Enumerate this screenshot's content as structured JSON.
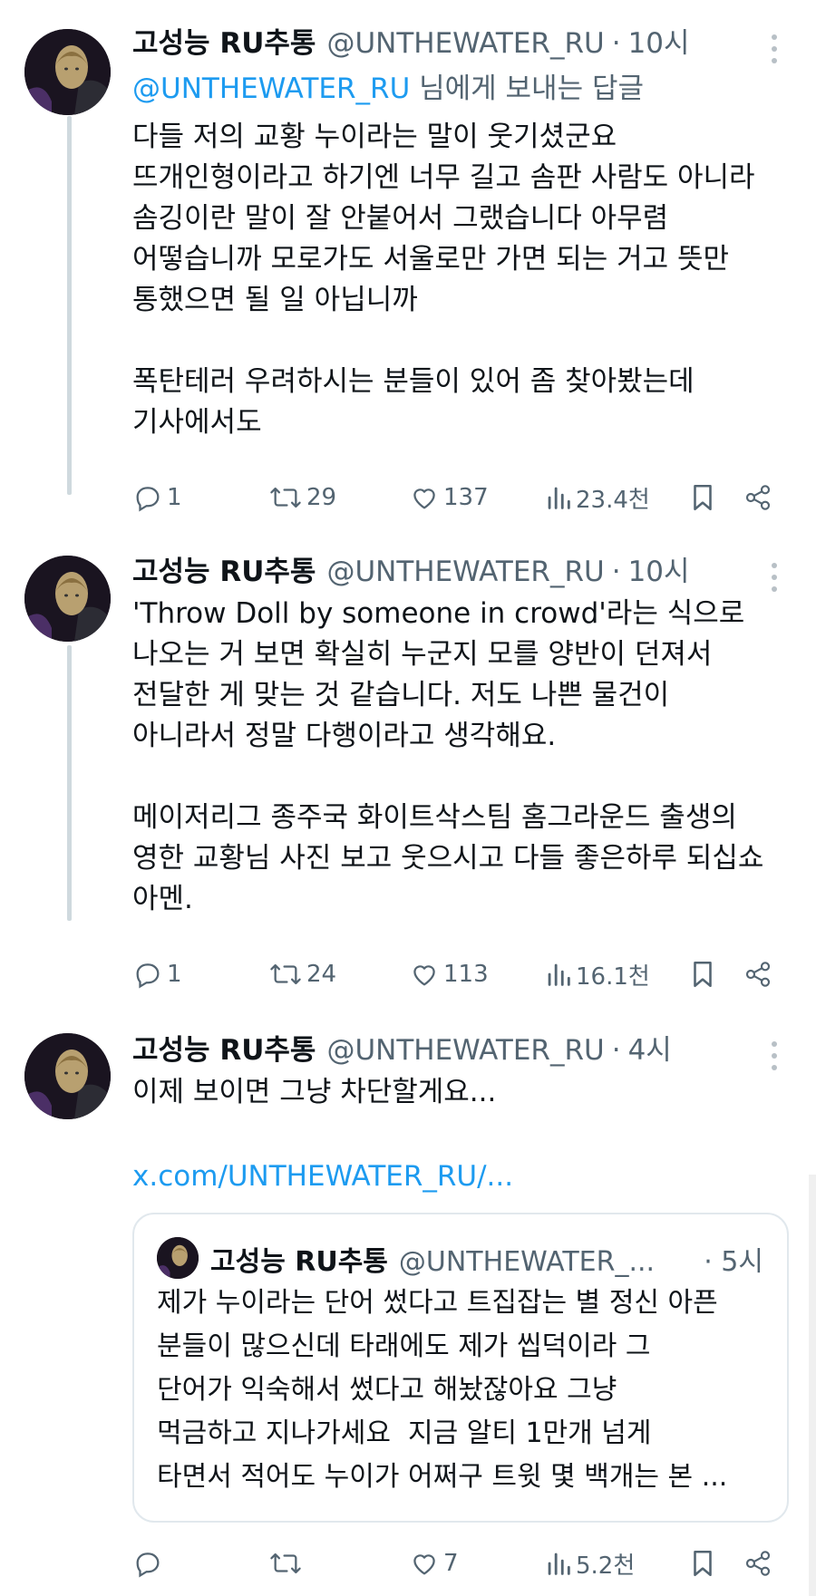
{
  "tweets": [
    {
      "name": "고성능 RU추통",
      "handle": "@UNTHEWATER_RU",
      "time": "10시",
      "reply_to": {
        "mention": "@UNTHEWATER_RU",
        "suffix": " 님에게 보내는 답글"
      },
      "body": "다들 저의 교황 누이라는 말이 웃기셨군요\n뜨개인형이라고 하기엔 너무 길고 솜판 사람도 아니라\n솜깅이란 말이 잘 안붙어서 그랬습니다 아무렴\n어떻습니까 모로가도 서울로만 가면 되는 거고 뜻만\n통했으면 될 일 아닙니까\n\n폭탄테러 우려하시는 분들이 있어 좀 찾아봤는데\n기사에서도",
      "stats": {
        "replies": "1",
        "retweets": "29",
        "likes": "137",
        "views": "23.4천"
      }
    },
    {
      "name": "고성능 RU추통",
      "handle": "@UNTHEWATER_RU",
      "time": "10시",
      "body": "'Throw Doll by someone in crowd'라는 식으로\n나오는 거 보면 확실히 누군지 모를 양반이 던져서\n전달한 게 맞는 것 같습니다. 저도 나쁜 물건이\n아니라서 정말 다행이라고 생각해요.\n\n메이저리그 종주국 화이트삭스팀 홈그라운드 출생의\n영한 교황님 사진 보고 웃으시고 다들 좋은하루 되십쇼\n아멘.",
      "stats": {
        "replies": "1",
        "retweets": "24",
        "likes": "113",
        "views": "16.1천"
      }
    },
    {
      "name": "고성능 RU추통",
      "handle": "@UNTHEWATER_RU",
      "time": "4시",
      "body": "이제 보이면 그냥 차단할게요...",
      "link": "x.com/UNTHEWATER_RU/...",
      "quote": {
        "name": "고성능 RU추통",
        "handle": "@UNTHEWATER_...",
        "time": "· 5시",
        "body": "제가 누이라는 단어 썼다고 트집잡는 별 정신 아픈\n분들이 많으신데 타래에도 제가 씹덕이라 그\n단어가 익숙해서 썼다고 해놨잖아요 그냥\n먹금하고 지나가세요  지금 알티 1만개 넘게\n타면서 적어도 누이가 어쩌구 트윗 몇 백개는 본 ..."
      },
      "stats": {
        "replies": "",
        "retweets": "",
        "likes": "7",
        "views": "5.2천"
      }
    }
  ],
  "separator": "·",
  "icons": [
    "reply-icon",
    "retweet-icon",
    "like-icon",
    "views-icon",
    "bookmark-icon",
    "share-icon",
    "more-icon"
  ],
  "colors": {
    "text": "#0f1419",
    "muted": "#536471",
    "link": "#1d9bf0",
    "thread_line": "#cfd9de"
  }
}
